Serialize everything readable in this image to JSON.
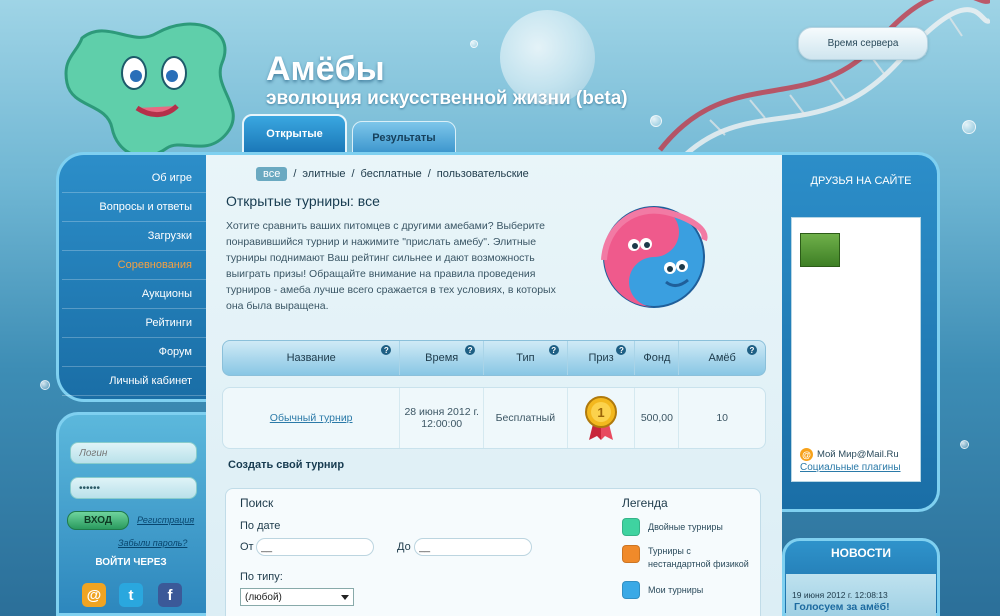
{
  "header": {
    "title": "Амёбы",
    "subtitle": "эволюция искусственной жизни (beta)",
    "server_time_label": "Время сервера"
  },
  "tabs": [
    {
      "label": "Открытые",
      "active": true
    },
    {
      "label": "Результаты",
      "active": false
    }
  ],
  "sidebar": {
    "items": [
      {
        "label": "Об игре",
        "active": false
      },
      {
        "label": "Вопросы и ответы",
        "active": false
      },
      {
        "label": "Загрузки",
        "active": false
      },
      {
        "label": "Соревнования",
        "active": true
      },
      {
        "label": "Аукционы",
        "active": false
      },
      {
        "label": "Рейтинги",
        "active": false
      },
      {
        "label": "Форум",
        "active": false
      },
      {
        "label": "Личный кабинет",
        "active": false
      }
    ]
  },
  "login": {
    "login_placeholder": "Логин",
    "password_value": "••••••",
    "submit_label": "ВХОД",
    "register_label": "Регистрация",
    "forgot_label": "Забыли пароль?",
    "login_via_label": "ВОЙТИ ЧЕРЕЗ",
    "providers": [
      {
        "icon": "mailru-icon",
        "glyph": "@",
        "color": "#f0a422"
      },
      {
        "icon": "twitter-icon",
        "glyph": "t",
        "color": "#2aa7de"
      },
      {
        "icon": "facebook-icon",
        "glyph": "f",
        "color": "#3b5998"
      }
    ]
  },
  "filters": {
    "items": [
      "все",
      "элитные",
      "бесплатные",
      "пользовательские"
    ],
    "active_index": 0,
    "separator": "/"
  },
  "main": {
    "title": "Открытые турниры: все",
    "intro": "Хотите сравнить ваших питомцев с другими амебами? Выберите понравившийся турнир и нажимите \"прислать амебу\". Элитные турниры поднимают Ваш рейтинг сильнее и дают возможность выиграть призы! Обращайте внимание на правила проведения турниров - амеба лучше всего сражается в тех условиях, в которых она была выращена.",
    "create_label": "Создать свой турнир"
  },
  "table": {
    "columns": [
      {
        "label": "Название",
        "help": true
      },
      {
        "label": "Время",
        "help": true
      },
      {
        "label": "Тип",
        "help": true
      },
      {
        "label": "Приз",
        "help": true
      },
      {
        "label": "Фонд",
        "help": true
      },
      {
        "label": "Амёб",
        "help": true
      }
    ],
    "help_glyph": "?",
    "rows": [
      {
        "name": "Обычный турнир",
        "time": "28 июня 2012 г. 12:00:00",
        "type": "Бесплатный",
        "prize_icon": "gold-medal-icon",
        "fund": "500,00",
        "amoebas": "10"
      }
    ]
  },
  "search": {
    "title": "Поиск",
    "by_date_label": "По дате",
    "from_label": "От",
    "from_value": "__",
    "to_label": "До",
    "to_value": "__",
    "by_type_label": "По типу:",
    "type_value": "(любой)"
  },
  "legend": {
    "title": "Легенда",
    "items": [
      {
        "label": "Двойные турниры",
        "color": "#3fd3a0"
      },
      {
        "label": "Турниры с нестандартной физикой",
        "color": "#f08a2a"
      },
      {
        "label": "Мои турниры",
        "color": "#3aa9e6"
      }
    ]
  },
  "right": {
    "friends_title": "ДРУЗЬЯ НА САЙТЕ",
    "mailru_label": "Мой Мир@Mail.Ru",
    "social_plugins_label": "Социальные плагины",
    "news_title": "НОВОСТИ",
    "news_date": "19 июня 2012 г. 12:08:13",
    "news_headline": "Голосуем за амёб!"
  },
  "colors": {
    "accent": "#1b78b8",
    "active_menu": "#f6a040",
    "link": "#2b7aa8"
  }
}
